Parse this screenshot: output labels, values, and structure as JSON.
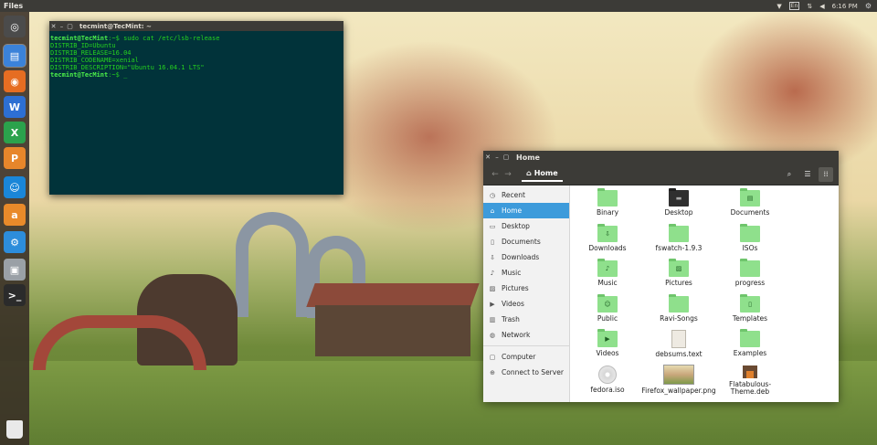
{
  "topbar": {
    "app_title": "Files",
    "clock": "6:16 PM",
    "keyboard_indicator": "En"
  },
  "launcher": {
    "items": [
      {
        "name": "ubuntu-dash-icon",
        "glyph": "◎",
        "color": "#4b4b4b"
      },
      {
        "name": "files-icon",
        "glyph": "▤",
        "color": "#3b82d9"
      },
      {
        "name": "firefox-icon",
        "glyph": "◉",
        "color": "#e66d22"
      },
      {
        "name": "writer-icon",
        "glyph": "W",
        "color": "#2d6fd3"
      },
      {
        "name": "calc-icon",
        "glyph": "X",
        "color": "#2ba24c"
      },
      {
        "name": "impress-icon",
        "glyph": "P",
        "color": "#e7862b"
      },
      {
        "name": "software-center-icon",
        "glyph": "☺",
        "color": "#1a86d8"
      },
      {
        "name": "amazon-icon",
        "glyph": "a",
        "color": "#e98a2a"
      },
      {
        "name": "system-settings-icon",
        "glyph": "⚙",
        "color": "#2d8ddb"
      },
      {
        "name": "screenshot-icon",
        "glyph": "▣",
        "color": "#9aa0a6"
      },
      {
        "name": "terminal-icon",
        "glyph": ">_",
        "color": "#2b2b2b"
      }
    ]
  },
  "terminal": {
    "title": "tecmint@TecMint: ~",
    "lines": [
      {
        "prompt": "tecmint@TecMint",
        "text": ":~$ sudo cat /etc/lsb-release"
      },
      {
        "prompt": "",
        "text": "DISTRIB_ID=Ubuntu"
      },
      {
        "prompt": "",
        "text": "DISTRIB_RELEASE=16.04"
      },
      {
        "prompt": "",
        "text": "DISTRIB_CODENAME=xenial"
      },
      {
        "prompt": "",
        "text": "DISTRIB_DESCRIPTION=\"Ubuntu 16.04.1 LTS\""
      },
      {
        "prompt": "tecmint@TecMint",
        "text": ":~$ _"
      }
    ]
  },
  "files_window": {
    "title": "Home",
    "path_label": "Home",
    "sidebar": [
      {
        "label": "Recent",
        "icon": "clock-icon",
        "glyph": "◷"
      },
      {
        "label": "Home",
        "icon": "home-icon",
        "glyph": "⌂",
        "active": true
      },
      {
        "label": "Desktop",
        "icon": "desktop-icon",
        "glyph": "▭"
      },
      {
        "label": "Documents",
        "icon": "document-icon",
        "glyph": "▯"
      },
      {
        "label": "Downloads",
        "icon": "download-icon",
        "glyph": "⇩"
      },
      {
        "label": "Music",
        "icon": "music-icon",
        "glyph": "♪"
      },
      {
        "label": "Pictures",
        "icon": "pictures-icon",
        "glyph": "▨"
      },
      {
        "label": "Videos",
        "icon": "video-icon",
        "glyph": "▶"
      },
      {
        "label": "Trash",
        "icon": "trash-icon",
        "glyph": "▥"
      },
      {
        "label": "Network",
        "icon": "network-icon",
        "glyph": "◍"
      },
      {
        "label": "Computer",
        "icon": "computer-icon",
        "glyph": "▢",
        "separator_before": true
      },
      {
        "label": "Connect to Server",
        "icon": "server-icon",
        "glyph": "⊕"
      }
    ],
    "items": [
      {
        "label": "Binary",
        "kind": "folder"
      },
      {
        "label": "Desktop",
        "kind": "folder-dark"
      },
      {
        "label": "Documents",
        "kind": "folder"
      },
      {
        "label": "Downloads",
        "kind": "folder"
      },
      {
        "label": "fswatch-1.9.3",
        "kind": "folder"
      },
      {
        "label": "ISOs",
        "kind": "folder"
      },
      {
        "label": "Music",
        "kind": "folder"
      },
      {
        "label": "Pictures",
        "kind": "folder"
      },
      {
        "label": "progress",
        "kind": "folder"
      },
      {
        "label": "Public",
        "kind": "folder"
      },
      {
        "label": "Ravi-Songs",
        "kind": "folder"
      },
      {
        "label": "Templates",
        "kind": "folder"
      },
      {
        "label": "Videos",
        "kind": "folder"
      },
      {
        "label": "debsums.text",
        "kind": "text"
      },
      {
        "label": "Examples",
        "kind": "folder"
      },
      {
        "label": "fedora.iso",
        "kind": "iso"
      },
      {
        "label": "Firefox_wallpaper.png",
        "kind": "png"
      },
      {
        "label": "Flatabulous-Theme.deb",
        "kind": "deb"
      }
    ]
  }
}
